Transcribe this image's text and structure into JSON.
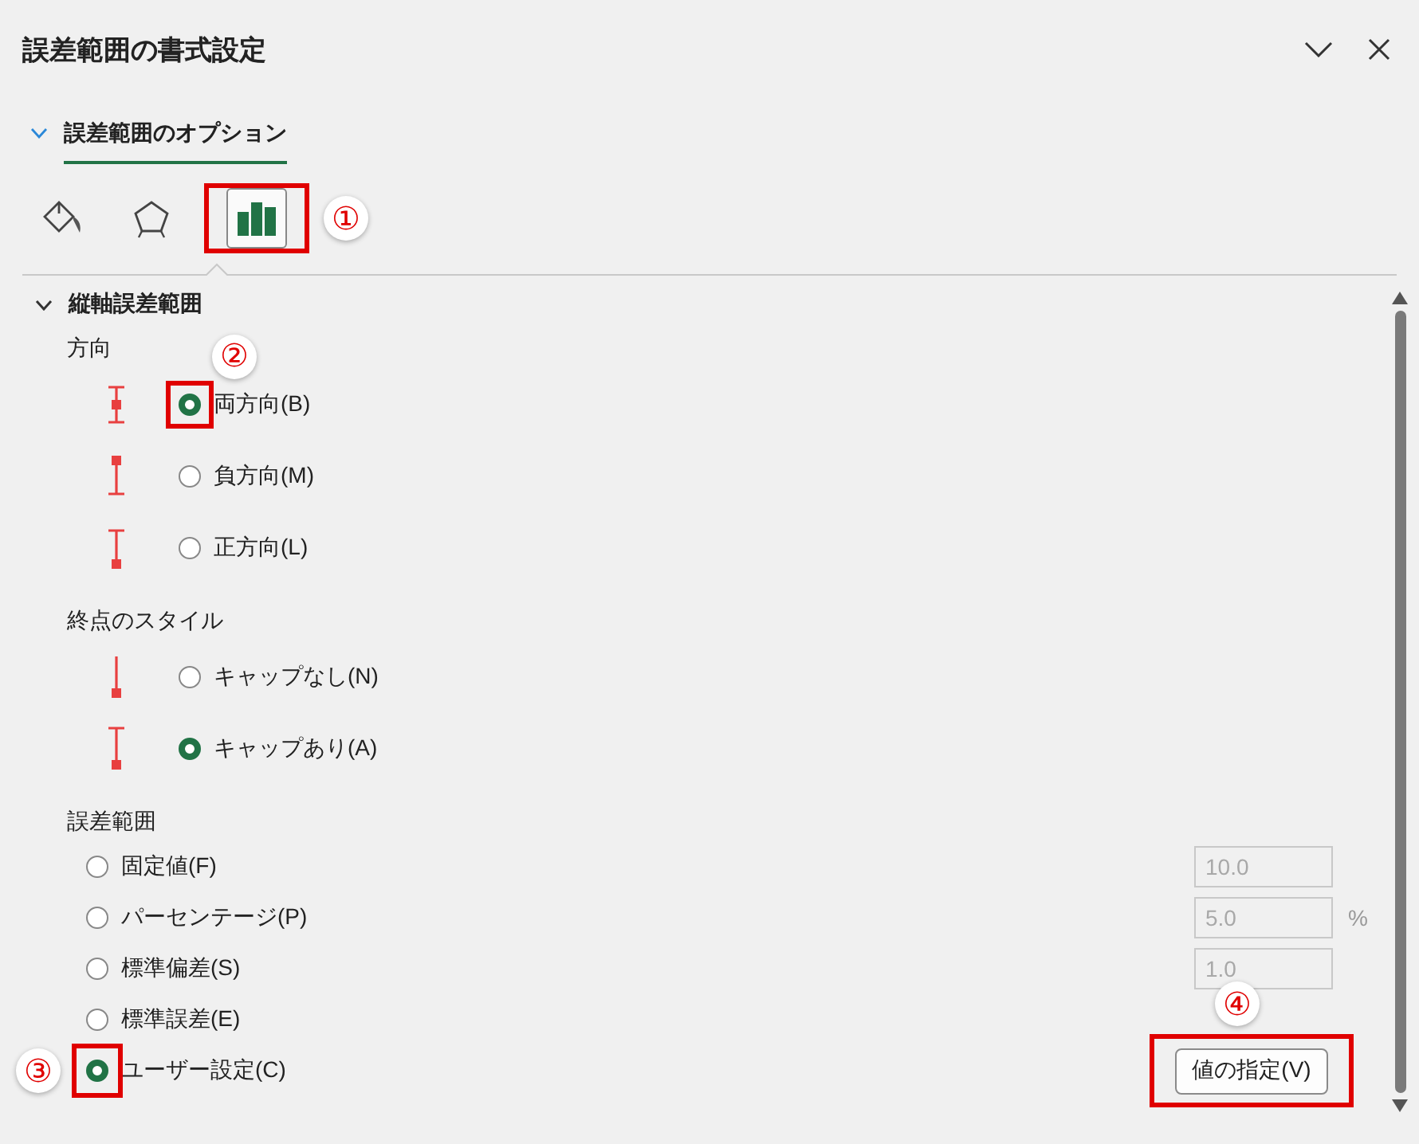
{
  "panel": {
    "title": "誤差範囲の書式設定"
  },
  "section_tab": {
    "label": "誤差範囲のオプション",
    "selected": true
  },
  "icon_tabs": [
    {
      "kind": "fill",
      "selected": false
    },
    {
      "kind": "effects",
      "selected": false
    },
    {
      "kind": "options",
      "selected": true,
      "callout": "①"
    }
  ],
  "group": {
    "title": "縦軸誤差範囲",
    "expanded": true
  },
  "direction": {
    "heading": "方向",
    "options": [
      {
        "kind": "both",
        "label": "両方向(B)",
        "selected": true,
        "callout": "②"
      },
      {
        "kind": "minus",
        "label": "負方向(M)",
        "selected": false
      },
      {
        "kind": "plus",
        "label": "正方向(L)",
        "selected": false
      }
    ]
  },
  "end_style": {
    "heading": "終点のスタイル",
    "options": [
      {
        "kind": "nocap",
        "label": "キャップなし(N)",
        "selected": false
      },
      {
        "kind": "cap",
        "label": "キャップあり(A)",
        "selected": true
      }
    ]
  },
  "error_amount": {
    "heading": "誤差範囲",
    "options": [
      {
        "label": "固定値(F)",
        "selected": false,
        "input": {
          "value": "10.0",
          "disabled": true
        }
      },
      {
        "label": "パーセンテージ(P)",
        "selected": false,
        "input": {
          "value": "5.0",
          "disabled": true
        },
        "unit": "%"
      },
      {
        "label": "標準偏差(S)",
        "selected": false,
        "input": {
          "value": "1.0",
          "disabled": true
        }
      },
      {
        "label": "標準誤差(E)",
        "selected": false
      },
      {
        "label": "ユーザー設定(C)",
        "selected": true,
        "callout": "③",
        "button": {
          "label": "値の指定(V)",
          "callout": "④"
        }
      }
    ]
  }
}
